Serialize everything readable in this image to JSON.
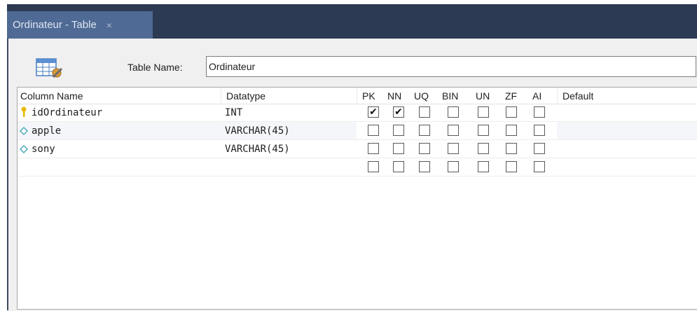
{
  "tab": {
    "title": "Ordinateur - Table",
    "close_glyph": "×"
  },
  "editor": {
    "table_name_label": "Table Name:",
    "table_name_value": "Ordinateur"
  },
  "grid": {
    "headers": {
      "column_name": "Column Name",
      "datatype": "Datatype",
      "pk": "PK",
      "nn": "NN",
      "uq": "UQ",
      "bin": "BIN",
      "un": "UN",
      "zf": "ZF",
      "ai": "AI",
      "default": "Default"
    },
    "rows": [
      {
        "icon": "primary-key-icon",
        "name": "idOrdinateur",
        "datatype": "INT",
        "pk": true,
        "nn": true,
        "uq": false,
        "bin": false,
        "un": false,
        "zf": false,
        "ai": false,
        "default": ""
      },
      {
        "icon": "column-diamond-icon",
        "name": "apple",
        "datatype": "VARCHAR(45)",
        "pk": false,
        "nn": false,
        "uq": false,
        "bin": false,
        "un": false,
        "zf": false,
        "ai": false,
        "default": ""
      },
      {
        "icon": "column-diamond-icon",
        "name": "sony",
        "datatype": "VARCHAR(45)",
        "pk": false,
        "nn": false,
        "uq": false,
        "bin": false,
        "un": false,
        "zf": false,
        "ai": false,
        "default": ""
      },
      {
        "icon": "",
        "name": "",
        "datatype": "",
        "pk": false,
        "nn": false,
        "uq": false,
        "bin": false,
        "un": false,
        "zf": false,
        "ai": false,
        "default": ""
      }
    ]
  },
  "colors": {
    "tabbar_bg": "#2c3a53",
    "tab_active_bg": "#4f6a94",
    "key_yellow": "#e8b800",
    "diamond_teal": "#3aa0b8"
  }
}
